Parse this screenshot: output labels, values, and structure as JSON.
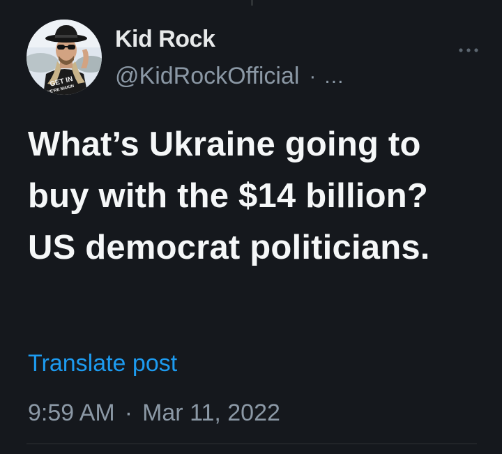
{
  "author": {
    "name": "Kid Rock",
    "handle": "@KidRockOfficial",
    "separator": "·",
    "inline_menu": "...",
    "avatar_shirt_text": [
      "GET IN",
      "WE'RE MAKIN"
    ]
  },
  "tweet": {
    "text": "What’s Ukraine going to buy with the $14 billion? US democrat politicians."
  },
  "translate_label": "Translate post",
  "timestamp": {
    "time": "9:59 AM",
    "separator": "·",
    "date": "Mar 11, 2022"
  },
  "icons": {
    "more": "more-horizontal-icon"
  },
  "colors": {
    "background": "#15181d",
    "primary_text": "#e7e9ea",
    "secondary_text": "#8b98a5",
    "link": "#1d9bf0",
    "divider": "#2f3336"
  }
}
